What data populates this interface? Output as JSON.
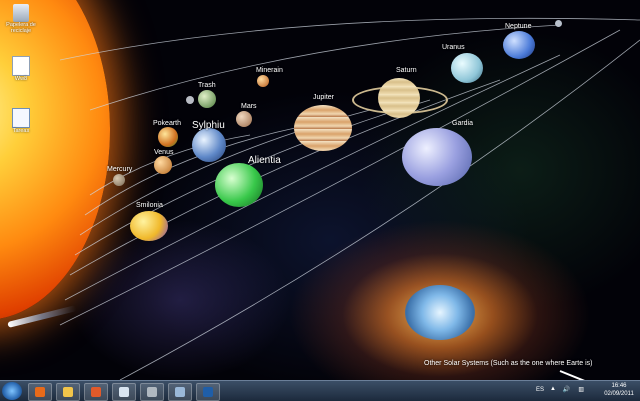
{
  "desktop_icons": [
    {
      "label": "Papelera de reciclaje",
      "icon": "recycle-bin-icon"
    },
    {
      "label": "Ww8",
      "icon": "document-icon"
    },
    {
      "label": "Tareas",
      "icon": "notepad-icon"
    }
  ],
  "planets": {
    "mercury": "Mercury",
    "venus": "Venus",
    "pokearth": "Pokearth",
    "trash": "Trash",
    "sylphiu": "Sylphiu",
    "mars": "Mars",
    "minerain": "Minerain",
    "jupiter": "Jupiter",
    "alientia": "Alientia",
    "smilonia": "Smilonia",
    "saturn": "Saturn",
    "uranus": "Uranus",
    "neptune": "Neptune",
    "gardia": "Gardia"
  },
  "annotation": "Other Solar Systems (Such as the one where Earte is)",
  "taskbar": {
    "pinned": [
      {
        "name": "firefox",
        "icon": "firefox-icon",
        "color": "#e86a1a"
      },
      {
        "name": "explorer",
        "icon": "folder-icon",
        "color": "#f2c54a"
      },
      {
        "name": "media",
        "icon": "media-player-icon",
        "color": "#e25a2a"
      },
      {
        "name": "notes",
        "icon": "notepad-icon",
        "color": "#d8e4f0"
      },
      {
        "name": "game",
        "icon": "game-icon",
        "color": "#b0b8c0"
      },
      {
        "name": "chrome",
        "icon": "browser-icon",
        "color": "#9ab8d8"
      },
      {
        "name": "photoshop",
        "icon": "photoshop-icon",
        "color": "#1f5ea8"
      }
    ],
    "language": "ES",
    "time": "16:46",
    "date": "02/09/2011"
  }
}
